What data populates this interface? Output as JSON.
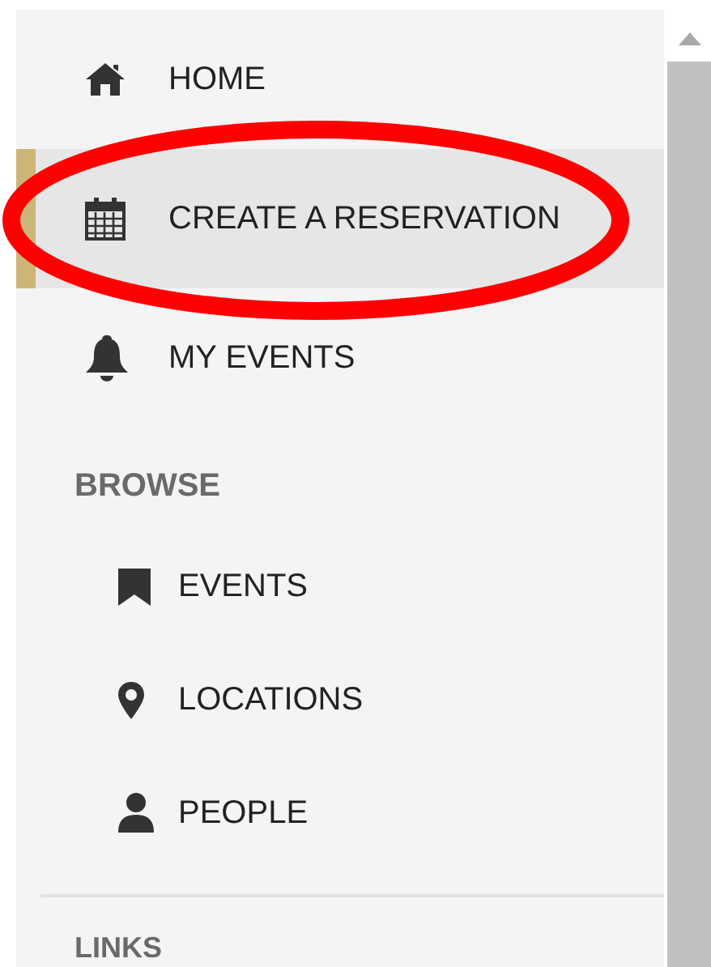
{
  "nav": [
    {
      "label": "HOME",
      "selected": false
    },
    {
      "label": "CREATE A RESERVATION",
      "selected": true
    },
    {
      "label": "MY EVENTS",
      "selected": false
    }
  ],
  "browse": {
    "heading": "BROWSE",
    "items": [
      {
        "label": "EVENTS"
      },
      {
        "label": "LOCATIONS"
      },
      {
        "label": "PEOPLE"
      }
    ]
  },
  "links": {
    "heading": "LINKS"
  }
}
